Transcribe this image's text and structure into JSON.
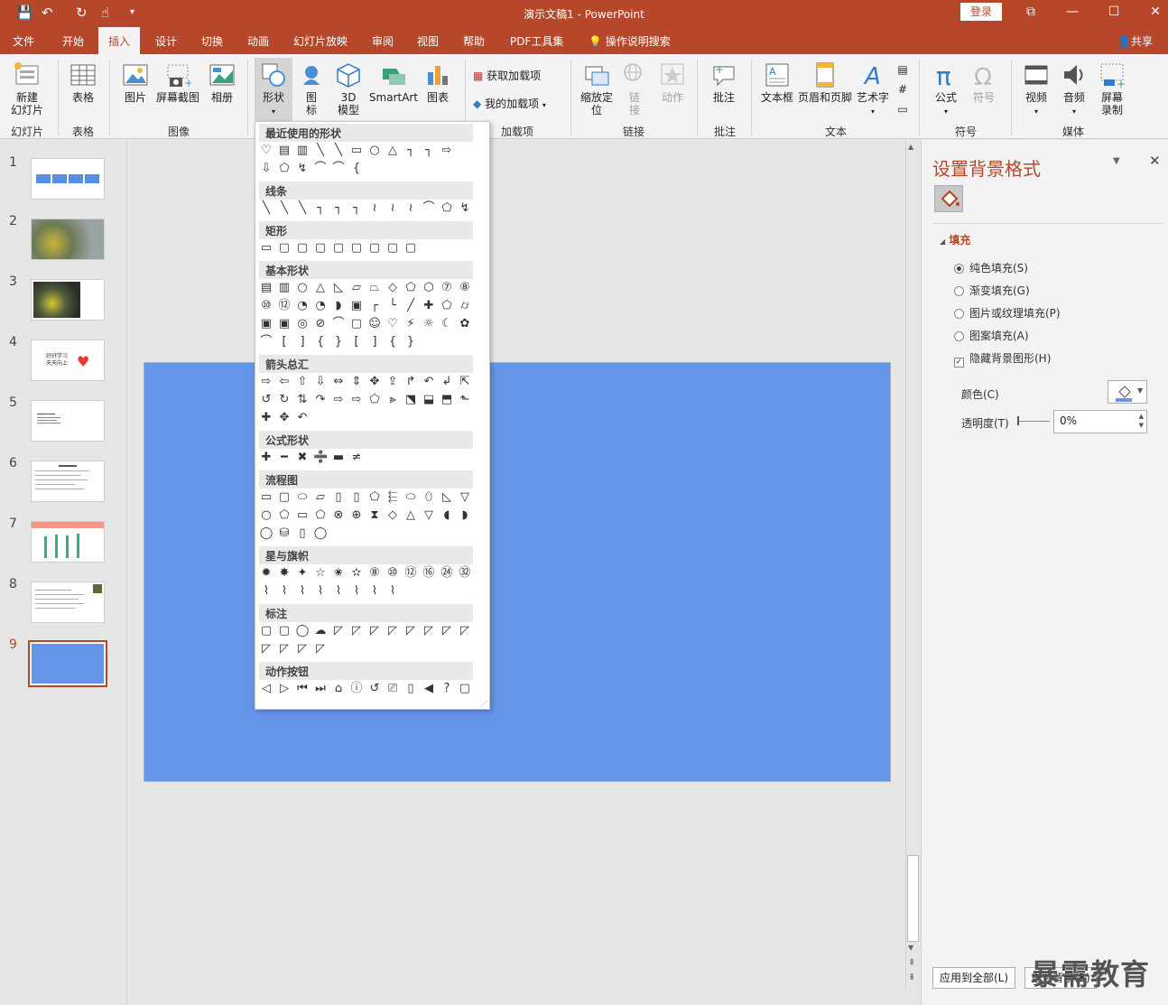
{
  "app": {
    "title": "演示文稿1  -  PowerPoint",
    "login": "登录"
  },
  "tabs": [
    "文件",
    "开始",
    "插入",
    "设计",
    "切换",
    "动画",
    "幻灯片放映",
    "审阅",
    "视图",
    "帮助",
    "PDF工具集"
  ],
  "tellme": "操作说明搜索",
  "share": "共享",
  "ribbon": {
    "new_slide": "新建\n幻灯片",
    "table": "表格",
    "picture": "图片",
    "screenshot": "屏幕截图",
    "album": "相册",
    "shapes": "形状",
    "icons": "图\n标",
    "model3d": "3D\n模型",
    "smartart": "SmartArt",
    "chart": "图表",
    "get_addins": "获取加载项",
    "my_addins": "我的加载项",
    "zoom": "缩放定\n位",
    "link": "链\n接",
    "action": "动作",
    "comment": "批注",
    "textbox": "文本框",
    "headerfooter": "页眉和页脚",
    "wordart": "艺术字",
    "equation": "公式",
    "symbol": "符号",
    "video": "视频",
    "audio": "音频",
    "screenrec": "屏幕\n录制",
    "groups": {
      "slides": "幻灯片",
      "tables": "表格",
      "images": "图像",
      "addins": "加载项",
      "links": "链接",
      "comments": "批注",
      "text": "文本",
      "symbols": "符号",
      "media": "媒体"
    }
  },
  "gallery": {
    "sections": [
      "最近使用的形状",
      "线条",
      "矩形",
      "基本形状",
      "箭头总汇",
      "公式形状",
      "流程图",
      "星与旗帜",
      "标注",
      "动作按钮"
    ]
  },
  "slides": [
    "1",
    "2",
    "3",
    "4",
    "5",
    "6",
    "7",
    "8",
    "9"
  ],
  "thumb4_text": "好好学习\n天天向上",
  "pane": {
    "title": "设置背景格式",
    "fill_section": "填充",
    "solid": "纯色填充(S)",
    "gradient": "渐变填充(G)",
    "picture": "图片或纹理填充(P)",
    "pattern": "图案填充(A)",
    "hide_bg": "隐藏背景图形(H)",
    "color_label": "颜色(C)",
    "transparency_label": "透明度(T)",
    "transparency_value": "0%",
    "apply_all": "应用到全部(L)",
    "reset": "重置背景(B)"
  },
  "watermark": "暴需教育",
  "colors": {
    "accent": "#b7472a",
    "slide_fill": "#6495e7"
  }
}
